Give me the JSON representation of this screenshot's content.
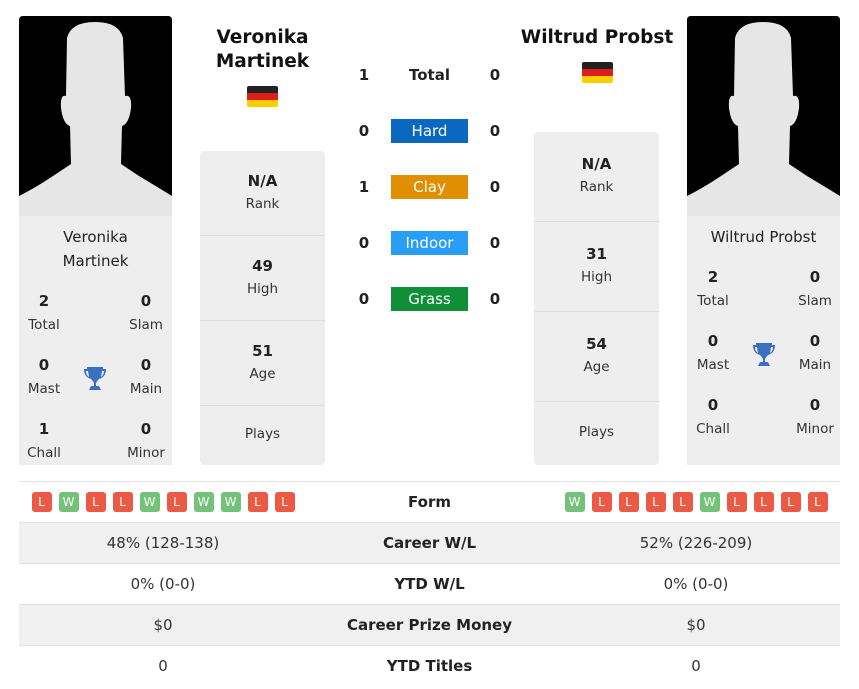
{
  "colors": {
    "hard": "#0a68c0",
    "clay": "#e08f00",
    "indoor": "#2a9df4",
    "grass": "#0f9038",
    "win": "#74c17a",
    "loss": "#ea5a45"
  },
  "player1": {
    "name": "Veronika Martinek",
    "card_name": "Veronika Martinek",
    "flag": "germany-flag",
    "titles": {
      "total": {
        "value": "2",
        "label": "Total"
      },
      "slam": {
        "value": "0",
        "label": "Slam"
      },
      "mast": {
        "value": "0",
        "label": "Mast"
      },
      "main": {
        "value": "0",
        "label": "Main"
      },
      "chall": {
        "value": "1",
        "label": "Chall"
      },
      "minor": {
        "value": "0",
        "label": "Minor"
      }
    },
    "stats": {
      "rank": {
        "value": "N/A",
        "label": "Rank"
      },
      "high": {
        "value": "49",
        "label": "High"
      },
      "age": {
        "value": "51",
        "label": "Age"
      },
      "plays": {
        "value": "",
        "label": "Plays"
      }
    },
    "form": [
      "L",
      "W",
      "L",
      "L",
      "W",
      "L",
      "W",
      "W",
      "L",
      "L"
    ]
  },
  "player2": {
    "name": "Wiltrud Probst",
    "card_name": "Wiltrud Probst",
    "flag": "germany-flag",
    "titles": {
      "total": {
        "value": "2",
        "label": "Total"
      },
      "slam": {
        "value": "0",
        "label": "Slam"
      },
      "mast": {
        "value": "0",
        "label": "Mast"
      },
      "main": {
        "value": "0",
        "label": "Main"
      },
      "chall": {
        "value": "0",
        "label": "Chall"
      },
      "minor": {
        "value": "0",
        "label": "Minor"
      }
    },
    "stats": {
      "rank": {
        "value": "N/A",
        "label": "Rank"
      },
      "high": {
        "value": "31",
        "label": "High"
      },
      "age": {
        "value": "54",
        "label": "Age"
      },
      "plays": {
        "value": "",
        "label": "Plays"
      }
    },
    "form": [
      "W",
      "L",
      "L",
      "L",
      "L",
      "W",
      "L",
      "L",
      "L",
      "L"
    ]
  },
  "h2h": [
    {
      "label": "Total",
      "p1": "1",
      "p2": "0",
      "type": "total"
    },
    {
      "label": "Hard",
      "p1": "0",
      "p2": "0",
      "type": "hard"
    },
    {
      "label": "Clay",
      "p1": "1",
      "p2": "0",
      "type": "clay"
    },
    {
      "label": "Indoor",
      "p1": "0",
      "p2": "0",
      "type": "indoor"
    },
    {
      "label": "Grass",
      "p1": "0",
      "p2": "0",
      "type": "grass"
    }
  ],
  "comparison": {
    "form_label": "Form",
    "rows": [
      {
        "label": "Career W/L",
        "p1": "48% (128-138)",
        "p2": "52% (226-209)"
      },
      {
        "label": "YTD W/L",
        "p1": "0% (0-0)",
        "p2": "0% (0-0)"
      },
      {
        "label": "Career Prize Money",
        "p1": "$0",
        "p2": "$0"
      },
      {
        "label": "YTD Titles",
        "p1": "0",
        "p2": "0"
      }
    ]
  }
}
